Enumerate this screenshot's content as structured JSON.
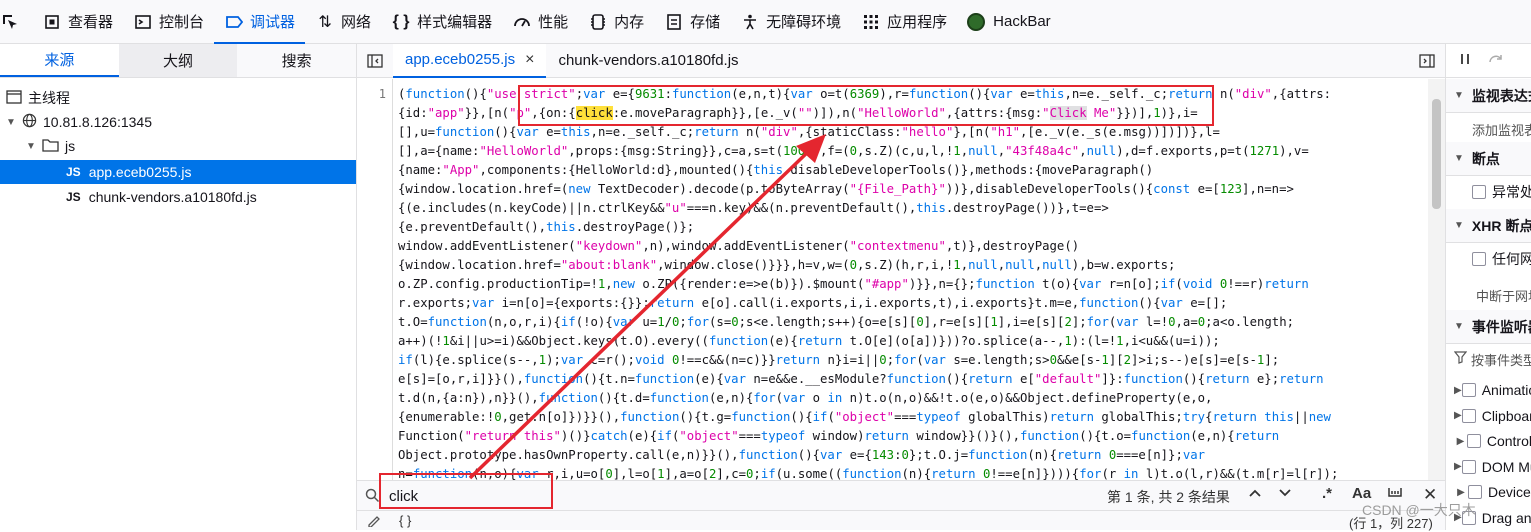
{
  "toolbar": {
    "tabs": [
      {
        "label": "",
        "icon": "inspect-icon"
      },
      {
        "label": "查看器",
        "icon": "inspector-icon"
      },
      {
        "label": "控制台",
        "icon": "console-icon"
      },
      {
        "label": "调试器",
        "icon": "debugger-icon",
        "active": true
      },
      {
        "label": "网络",
        "icon": "network-icon"
      },
      {
        "label": "样式编辑器",
        "icon": "style-editor-icon"
      },
      {
        "label": "性能",
        "icon": "performance-icon"
      },
      {
        "label": "内存",
        "icon": "memory-icon"
      },
      {
        "label": "存储",
        "icon": "storage-icon"
      },
      {
        "label": "无障碍环境",
        "icon": "accessibility-icon"
      },
      {
        "label": "应用程序",
        "icon": "application-icon"
      },
      {
        "label": "HackBar",
        "icon": "hackbar-icon"
      }
    ]
  },
  "left_panel": {
    "tabs": [
      "来源",
      "大纲",
      "搜索"
    ],
    "tree": {
      "main_thread": "主线程",
      "host": "10.81.8.126:1345",
      "folder": "js",
      "badge": "JS",
      "files": [
        "app.eceb0255.js",
        "chunk-vendors.a10180fd.js"
      ]
    }
  },
  "editor": {
    "tabs": [
      "app.eceb0255.js",
      "chunk-vendors.a10180fd.js"
    ],
    "close_glyph": "×",
    "line_number": "1",
    "lines": [
      "(function(){\"use strict\";var e={9631:function(e,n,t){var o=t(6369),r=function(){var e=this,n=e._self._c;return n(\"div\",{attrs:",
      "{id:\"app\"}},[n(\"p\",{on:{click:e.moveParagraph}},[e._v(\"\")]),n(\"HelloWorld\",{attrs:{msg:\"Click Me\"}})],1)},i=",
      "[],u=function(){var e=this,n=e._self._c;return n(\"div\",{staticClass:\"hello\"},[n(\"h1\",[e._v(e._s(e.msg))])])},l=",
      "[],a={name:\"HelloWorld\",props:{msg:String}},c=a,s=t(1001),f=(0,s.Z)(c,u,l,!1,null,\"43f48a4c\",null),d=f.exports,p=t(1271),v=",
      "{name:\"App\",components:{HelloWorld:d},mounted(){this.disableDeveloperTools()},methods:{moveParagraph()",
      "{window.location.href=(new TextDecoder).decode(p.toByteArray(\"{File_Path}\"))},disableDeveloperTools(){const e=[123],n=n=>",
      "{(e.includes(n.keyCode)||n.ctrlKey&&\"u\"===n.key)&&(n.preventDefault(),this.destroyPage())},t=e=>",
      "{e.preventDefault(),this.destroyPage()};",
      "window.addEventListener(\"keydown\",n),window.addEventListener(\"contextmenu\",t)},destroyPage()",
      "{window.location.href=\"about:blank\",window.close()}}},h=v,w=(0,s.Z)(h,r,i,!1,null,null,null),b=w.exports;",
      "o.ZP.config.productionTip=!1,new o.ZP({render:e=>e(b)}).$mount(\"#app\")}},n={};function t(o){var r=n[o];if(void 0!==r)return",
      "r.exports;var i=n[o]={exports:{}};return e[o].call(i.exports,i,i.exports,t),i.exports}t.m=e,function(){var e=[];",
      "t.O=function(n,o,r,i){if(!o){var u=1/0;for(s=0;s<e.length;s++){o=e[s][0],r=e[s][1],i=e[s][2];for(var l=!0,a=0;a<o.length;",
      "a++)(!1&i||u>=i)&&Object.keys(t.O).every((function(e){return t.O[e](o[a])}))?o.splice(a--,1):(l=!1,i<u&&(u=i));",
      "if(l){e.splice(s--,1);var c=r();void 0!==c&&(n=c)}}return n}i=i||0;for(var s=e.length;s>0&&e[s-1][2]>i;s--)e[s]=e[s-1];",
      "e[s]=[o,r,i]}}(),function(){t.n=function(e){var n=e&&e.__esModule?function(){return e[\"default\"]}:function(){return e};return",
      "t.d(n,{a:n}),n}}(),function(){t.d=function(e,n){for(var o in n)t.o(n,o)&&!t.o(e,o)&&Object.defineProperty(e,o,",
      "{enumerable:!0,get:n[o]})}}(),function(){t.g=function(){if(\"object\"===typeof globalThis)return globalThis;try{return this||new",
      "Function(\"return this\")()}catch(e){if(\"object\"===typeof window)return window}}()}(),function(){t.o=function(e,n){return",
      "Object.prototype.hasOwnProperty.call(e,n)}}(),function(){var e={143:0};t.O.j=function(n){return 0===e[n]};var",
      "n=function(n,o){var r,i,u=o[0],l=o[1],a=o[2],c=0;if(u.some((function(n){return 0!==e[n]}))){for(r in l)t.o(l,r)&&(t.m[r]=l[r]);"
    ]
  },
  "search": {
    "value": "click",
    "status": "第 1 条, 共 2 条结果",
    "modifier_regex": ".*",
    "modifier_case": "Aa",
    "modifier_word": "\\b"
  },
  "statusbar": {
    "left": "{ }",
    "position": "(行 1，列 227)"
  },
  "right_panel": {
    "sections": [
      {
        "header": "监视表达式",
        "plain": "添加监视表达式"
      },
      {
        "header": "断点",
        "checkbox": "异常处暂停"
      },
      {
        "header": "XHR 断点",
        "checkbox": "任何网址",
        "plain": "中断于网址包含"
      },
      {
        "header": "事件监听器断点",
        "filter": "按事件类型过滤"
      }
    ],
    "events": [
      "Animation",
      "Clipboard",
      "Control",
      "DOM Mutation",
      "Device",
      "Drag and Drop"
    ]
  },
  "watermark": "CSDN @一大只木"
}
